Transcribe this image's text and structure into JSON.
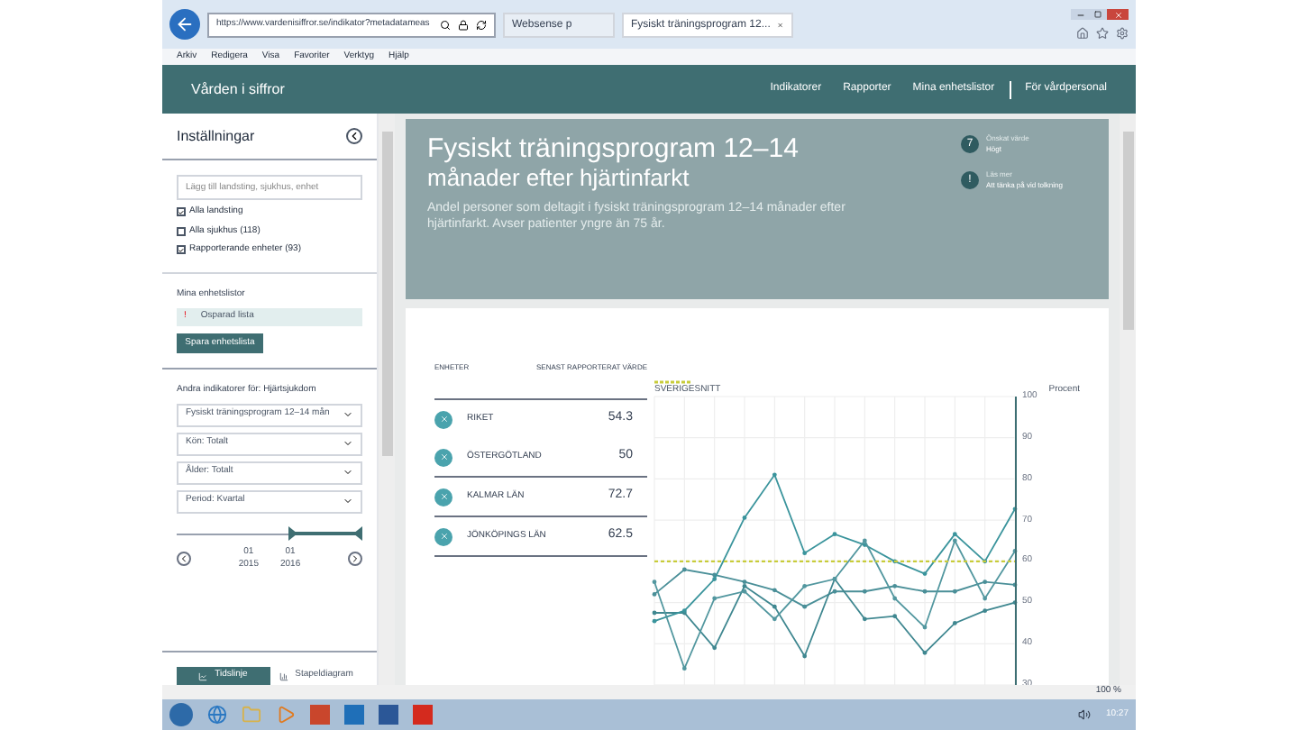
{
  "browser": {
    "address": "https://www.vardenisiffror.se/indikator?metadatameas",
    "tabs": [
      {
        "label": "Websense p",
        "selected": false
      },
      {
        "label": "Fysiskt träningsprogram 12...",
        "selected": true
      }
    ],
    "menu": [
      "Arkiv",
      "Redigera",
      "Visa",
      "Favoriter",
      "Verktyg",
      "Hjälp"
    ],
    "zoom": "100 %"
  },
  "header": {
    "logo": "Vården i siffror",
    "nav": [
      "Indikatorer",
      "Rapporter",
      "Mina enhetslistor",
      "För vårdpersonal"
    ]
  },
  "sidebar": {
    "title": "Inställningar",
    "search": {
      "placeholder": "Lägg till landsting, sjukhus, enhet"
    },
    "checkboxes": [
      {
        "label": "Alla landsting",
        "checked": true
      },
      {
        "label": "Alla sjukhus (118)",
        "checked": false
      },
      {
        "label": "Rapporterande enheter (93)",
        "checked": true
      }
    ],
    "lists_title": "Mina enhetslistor",
    "list_item": {
      "mark": "!",
      "label": "Osparad lista"
    },
    "save_button": "Spara enhetslista",
    "other_title": "Andra indikatorer för: Hjärtsjukdom",
    "dropdowns": [
      "Fysiskt träningsprogram 12–14 mån",
      "Kön: Totalt",
      "Ålder: Totalt",
      "Period: Kvartal"
    ],
    "timeline": {
      "level": 0.38,
      "start": "01",
      "start_year": "2015",
      "end": "01",
      "end_year": "2016"
    },
    "view_tabs": [
      {
        "label": "Tidslinje",
        "kind": "line",
        "selected": true
      },
      {
        "label": "Stapeldiagram",
        "kind": "bar",
        "selected": false
      }
    ]
  },
  "indicator": {
    "title": "Fysiskt träningsprogram 12–14",
    "subtitle": "månader efter hjärtinfarkt",
    "description": "Andel personer som deltagit i fysiskt träningsprogram 12–14 månader efter hjärtinfarkt. Avser patienter yngre än 75 år.",
    "info": [
      {
        "badge": "7",
        "label": "Önskat värde",
        "value": "Högt"
      },
      {
        "badge": "!",
        "label": "Läs mer",
        "value": "Att tänka på vid tolkning"
      }
    ]
  },
  "units": {
    "columns": [
      "ENHETER",
      "SENAST RAPPORTERAT VÄRDE"
    ],
    "rows": [
      {
        "value": "54.3"
      },
      {
        "value": "50"
      },
      {
        "value": "72.7"
      },
      {
        "value": "62.5"
      }
    ],
    "chart_data": {
      "type": "line",
      "grid": true,
      "ylabel": "Procent",
      "ylim": [
        30,
        100
      ],
      "yticks": [
        30,
        40,
        50,
        60,
        70,
        80,
        90,
        100
      ],
      "series": [
        {
          "name": "RIKET",
          "color": "#4a8f98",
          "values": [
            52,
            58,
            56.7,
            55,
            53,
            49,
            52.7,
            52.7,
            54,
            52.7,
            52.7,
            55,
            54.3
          ]
        },
        {
          "name": "ÖSTERGÖTLAND",
          "color": "#3f8790",
          "values": [
            47.5,
            47.5,
            39,
            54,
            49,
            37,
            55.7,
            46,
            46.7,
            37.8,
            45,
            48,
            50
          ]
        },
        {
          "name": "KALMAR LÄN",
          "color": "#3a949c",
          "values": [
            45.5,
            48,
            55.7,
            70.6,
            81,
            62,
            66.6,
            64,
            60,
            57,
            66.6,
            60,
            72.7
          ]
        },
        {
          "name": "JÖNKÖPINGS LÄN",
          "color": "#52979f",
          "values": [
            55,
            34,
            51,
            52.7,
            46,
            54,
            55.7,
            65,
            51,
            44,
            65,
            51,
            62.5
          ]
        },
        {
          "name": "SVERIGESNITT",
          "color": "#c8cc3a",
          "line_style": "dashed",
          "values": [
            60,
            60,
            60,
            60,
            60,
            60,
            60,
            60,
            60,
            60,
            60,
            60,
            60
          ]
        }
      ]
    }
  },
  "taskbar": {
    "clock": "10:27"
  }
}
